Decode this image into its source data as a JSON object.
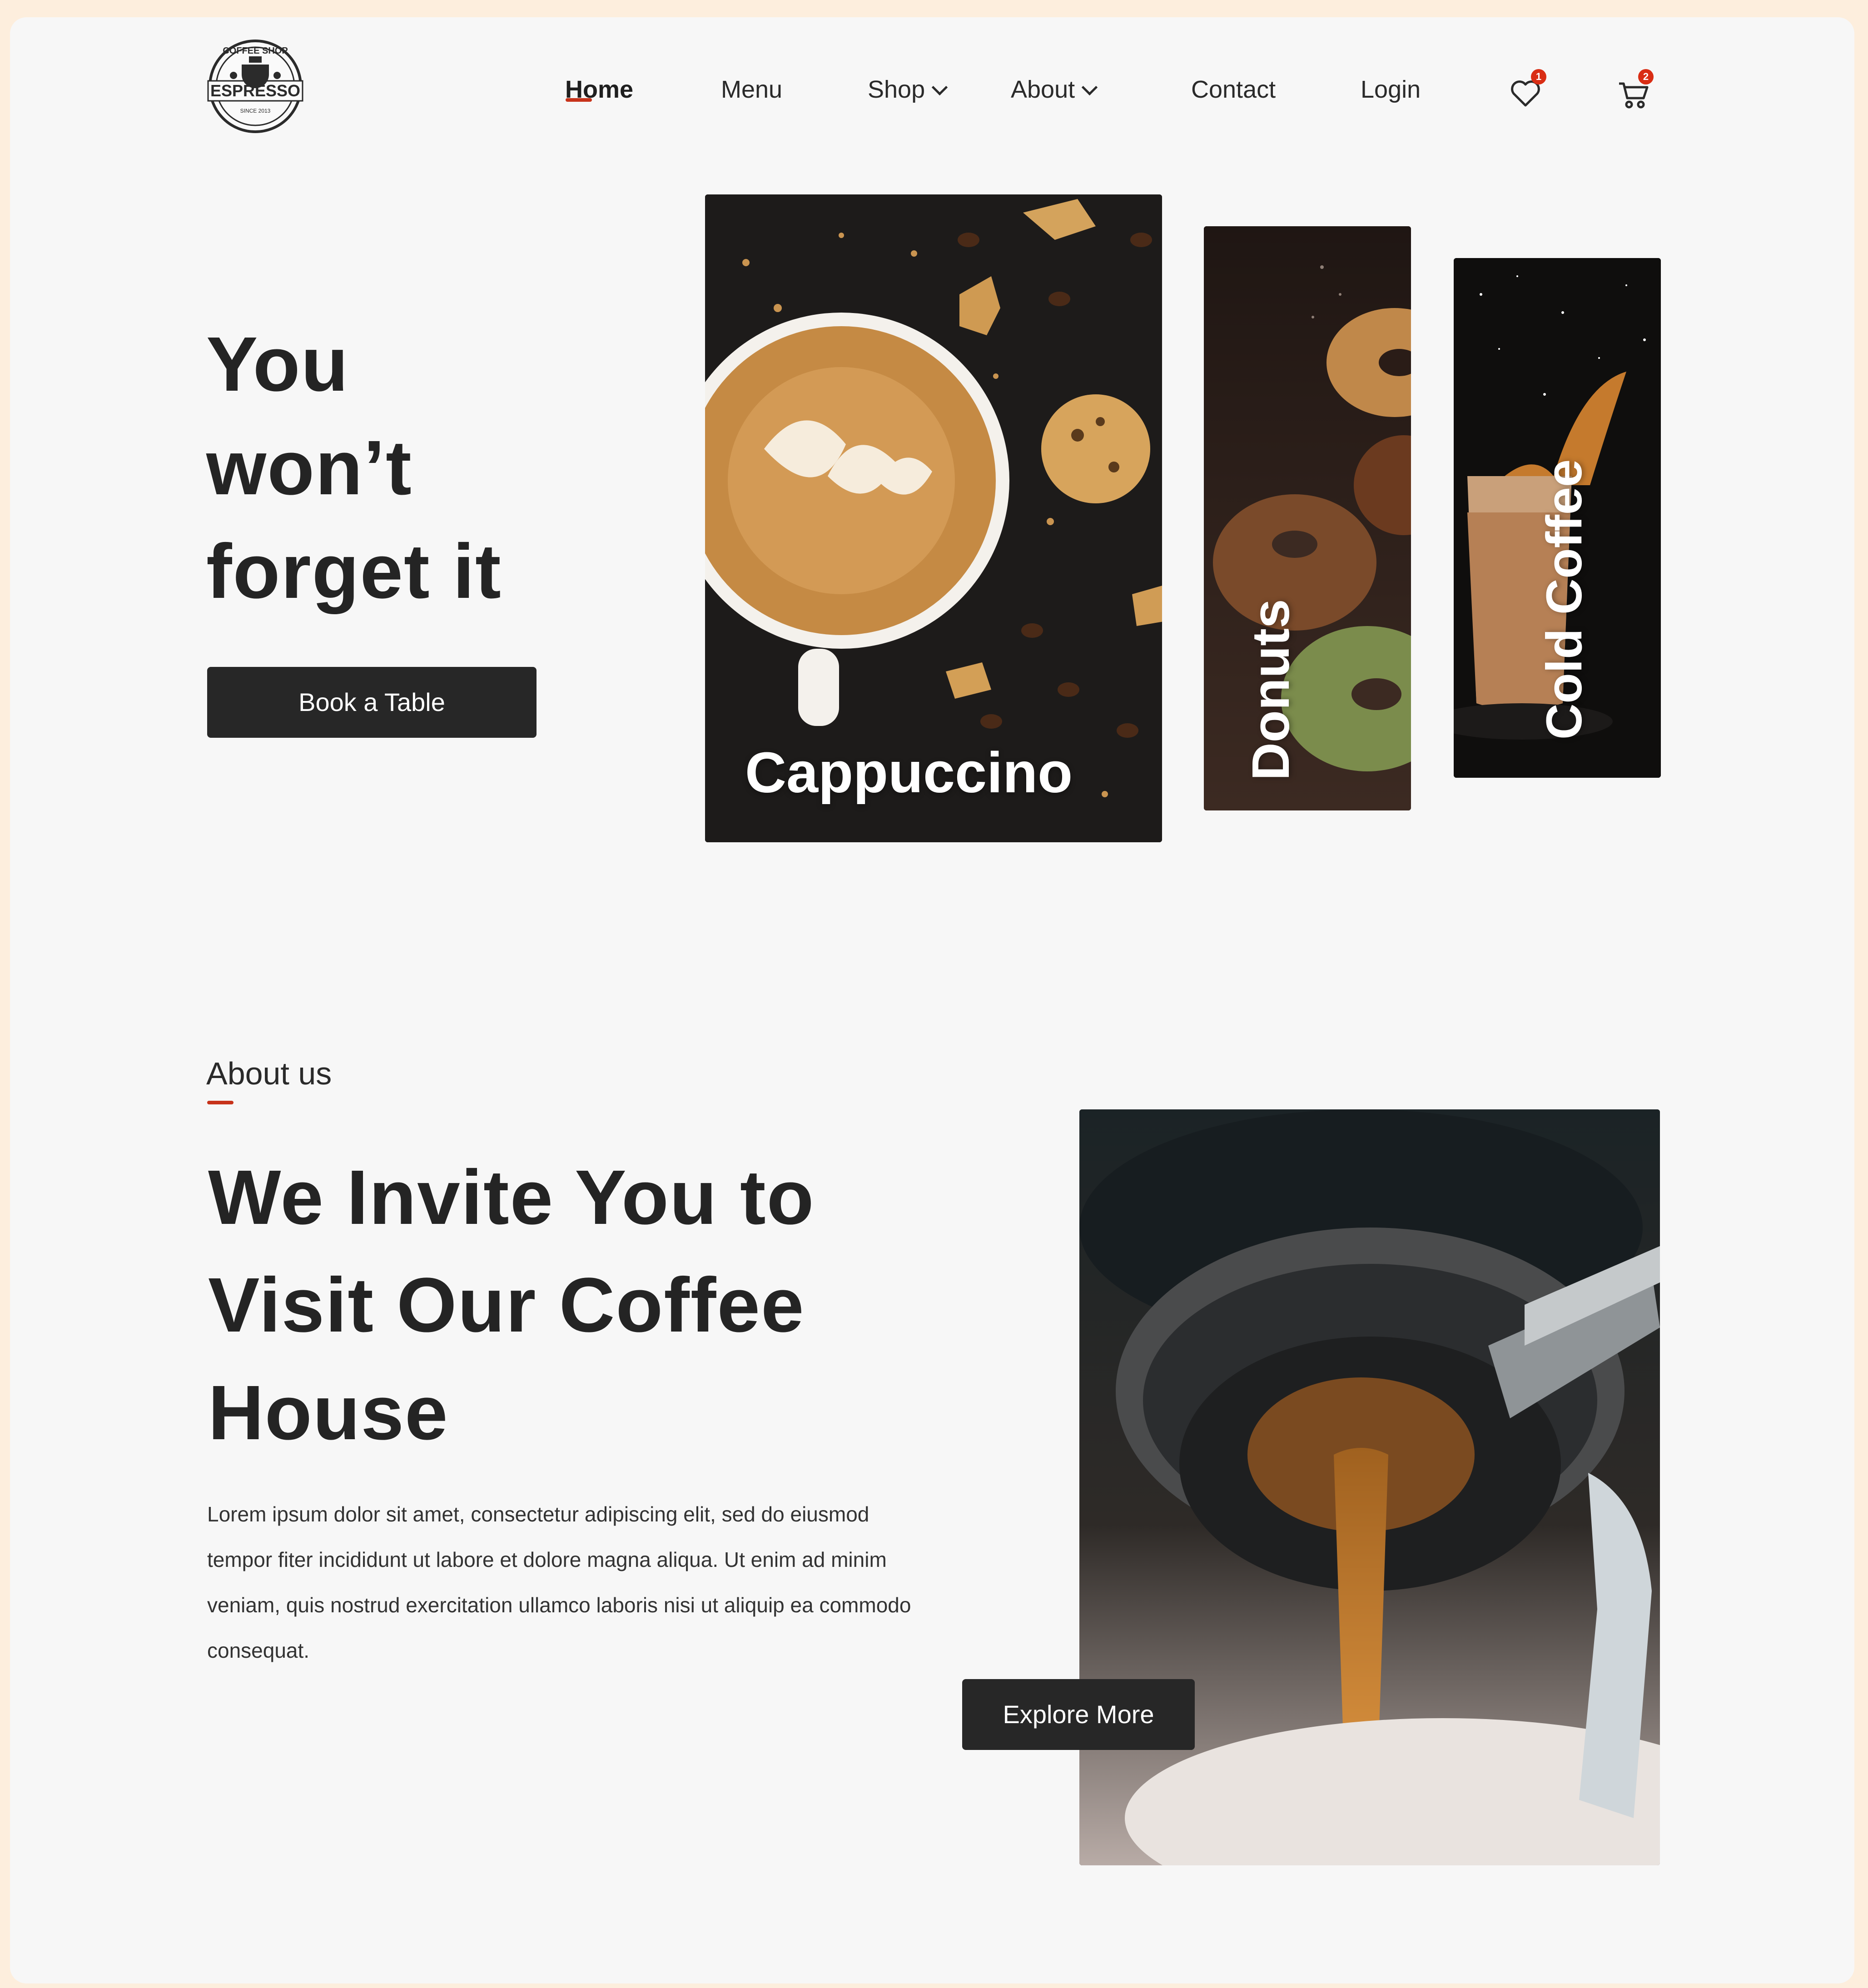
{
  "brand": {
    "logo_top_text": "COFFEE SHOP",
    "logo_name": "ESPRESSO",
    "logo_year": "SINCE 2013"
  },
  "nav": {
    "items": [
      {
        "label": "Home",
        "active": true
      },
      {
        "label": "Menu"
      },
      {
        "label": "Shop",
        "dropdown": true
      },
      {
        "label": "About",
        "dropdown": true
      },
      {
        "label": "Contact"
      },
      {
        "label": "Login"
      }
    ],
    "wishlist_count": "1",
    "cart_count": "2",
    "wishlist_icon": "heart-icon",
    "cart_icon": "cart-icon"
  },
  "hero": {
    "title_lines": [
      "You",
      "won’t",
      "forget it"
    ],
    "cta_label": "Book a Table",
    "cards": [
      {
        "label": "Cappuccino"
      },
      {
        "label": "Donuts"
      },
      {
        "label": "Cold Coffee"
      }
    ]
  },
  "about": {
    "eyebrow": "About us",
    "title_lines": [
      "We Invite You to",
      "Visit Our Coffee",
      "House"
    ],
    "body": "Lorem ipsum dolor sit amet, consectetur adipiscing elit, sed do eiusmod tempor fiter incididunt ut labore et dolore magna aliqua. Ut enim ad minim veniam, quis nostrud exercitation ullamco laboris nisi ut aliquip ea commodo consequat.",
    "cta_label": "Explore More"
  },
  "colors": {
    "accent": "#c7331b",
    "dark": "#272727",
    "page_bg": "#f7f7f7",
    "outer_bg": "#fdeedd"
  }
}
